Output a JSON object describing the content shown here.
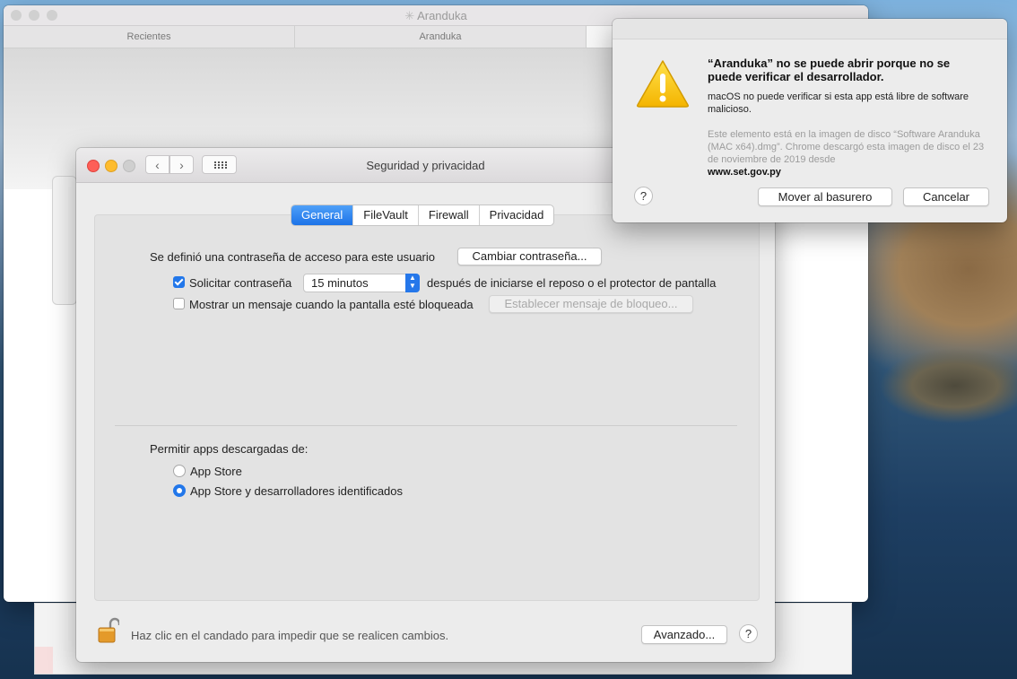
{
  "background_window": {
    "title": "Aranduka",
    "tabs": [
      "Recientes",
      "Aranduka"
    ]
  },
  "prefs_window": {
    "title": "Seguridad y privacidad",
    "tabs": {
      "general": "General",
      "filevault": "FileVault",
      "firewall": "Firewall",
      "privacy": "Privacidad"
    },
    "active_tab": "General",
    "password_set_label": "Se definió una contraseña de acceso para este usuario",
    "change_password_button": "Cambiar contraseña...",
    "require_password_label": "Solicitar contraseña",
    "require_password_checked": true,
    "require_password_delay": "15 minutos",
    "require_password_suffix": "después de iniciarse el reposo o el protector de pantalla",
    "show_message_label": "Mostrar un mensaje cuando la pantalla esté bloqueada",
    "show_message_checked": false,
    "set_lock_message_button": "Establecer mensaje de bloqueo...",
    "allow_apps_label": "Permitir apps descargadas de:",
    "allow_options": {
      "app_store": "App Store",
      "app_store_identified": "App Store y desarrolladores identificados"
    },
    "selected_allow_option": "App Store y desarrolladores identificados",
    "lock_hint": "Haz clic en el candado para impedir que se realicen cambios.",
    "advanced_button": "Avanzado...",
    "help_label": "?"
  },
  "alert": {
    "title": "“Aranduka” no se puede abrir porque no se puede verificar el desarrollador.",
    "message": "macOS no puede verificar si esta app está libre de software malicioso.",
    "info": "Este elemento está en la imagen de disco “Software Aranduka (MAC x64).dmg”. Chrome descargó esta imagen de disco el 23 de noviembre de 2019 desde",
    "host": "www.set.gov.py",
    "help_label": "?",
    "move_to_trash_button": "Mover al basurero",
    "cancel_button": "Cancelar"
  },
  "colors": {
    "accent": "#1c73e8",
    "close": "#fe5f57",
    "minimize": "#febc2e",
    "zoom_disabled": "#cfcfcf"
  }
}
